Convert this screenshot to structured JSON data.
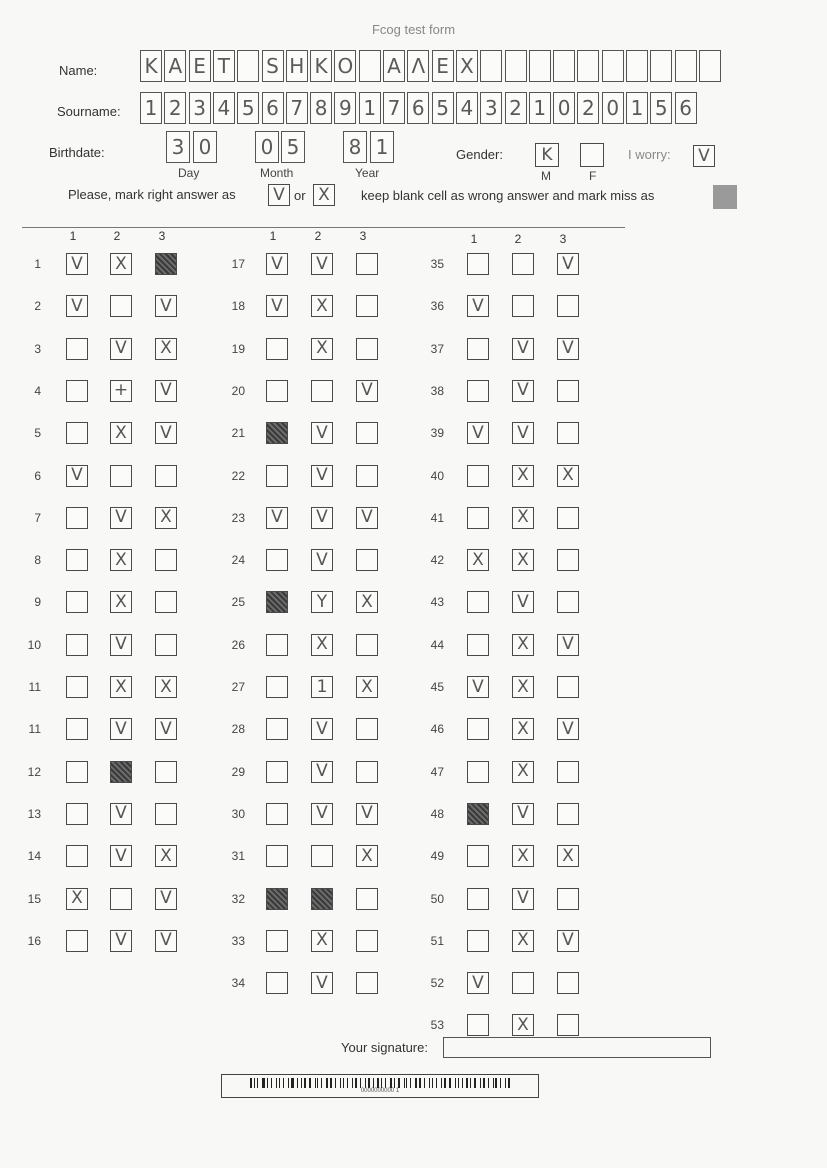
{
  "title": "Fcog test form",
  "labels": {
    "name": "Name:",
    "surname": "Sourname:",
    "birthdate": "Birthdate:",
    "day": "Day",
    "month": "Month",
    "year": "Year",
    "gender": "Gender:",
    "male": "M",
    "female": "F",
    "worry": "I worry:",
    "instructions_a": "Please, mark right answer as",
    "or": "or",
    "instructions_b": "keep blank cell as wrong answer and mark miss as",
    "signature": "Your signature:"
  },
  "name_chars": [
    "K",
    "A",
    "E",
    "T",
    "",
    "S",
    "H",
    "K",
    "O",
    "",
    "A",
    "Λ",
    "E",
    "X",
    "",
    "",
    "",
    "",
    "",
    "",
    "",
    "",
    "",
    ""
  ],
  "surname_chars": [
    "1",
    "2",
    "3",
    "4",
    "5",
    "6",
    "7",
    "8",
    "9",
    "1",
    "7",
    "6",
    "5",
    "4",
    "3",
    "2",
    "1",
    "0",
    "2",
    "0",
    "1",
    "5",
    "6"
  ],
  "birthdate": {
    "day": [
      "3",
      "0"
    ],
    "month": [
      "0",
      "5"
    ],
    "year": [
      "8",
      "1"
    ]
  },
  "gender": {
    "male": "K",
    "female": ""
  },
  "worry": "V",
  "legend_marks": {
    "right_v": "V",
    "right_x": "X"
  },
  "column_headers": [
    "1",
    "2",
    "3"
  ],
  "questions": [
    {
      "n": "1",
      "m": [
        "V",
        "X",
        "#"
      ]
    },
    {
      "n": "2",
      "m": [
        "V",
        "",
        "V"
      ]
    },
    {
      "n": "3",
      "m": [
        "",
        "V",
        "X"
      ]
    },
    {
      "n": "4",
      "m": [
        "",
        "+",
        "V"
      ]
    },
    {
      "n": "5",
      "m": [
        "",
        "X",
        "V"
      ]
    },
    {
      "n": "6",
      "m": [
        "V",
        "",
        ""
      ]
    },
    {
      "n": "7",
      "m": [
        "",
        "V",
        "X"
      ]
    },
    {
      "n": "8",
      "m": [
        "",
        "X",
        ""
      ]
    },
    {
      "n": "9",
      "m": [
        "",
        "X",
        ""
      ]
    },
    {
      "n": "10",
      "m": [
        "",
        "V",
        ""
      ]
    },
    {
      "n": "11",
      "m": [
        "",
        "X",
        "X"
      ]
    },
    {
      "n": "11",
      "m": [
        "",
        "V",
        "V"
      ]
    },
    {
      "n": "12",
      "m": [
        "",
        "#",
        ""
      ]
    },
    {
      "n": "13",
      "m": [
        "",
        "V",
        ""
      ]
    },
    {
      "n": "14",
      "m": [
        "",
        "V",
        "X"
      ]
    },
    {
      "n": "15",
      "m": [
        "X",
        "",
        "V"
      ]
    },
    {
      "n": "16",
      "m": [
        "",
        "V",
        "V"
      ]
    },
    {
      "n": "17",
      "m": [
        "V",
        "V",
        ""
      ]
    },
    {
      "n": "18",
      "m": [
        "V",
        "X",
        ""
      ]
    },
    {
      "n": "19",
      "m": [
        "",
        "X",
        ""
      ]
    },
    {
      "n": "20",
      "m": [
        "",
        "",
        "V"
      ]
    },
    {
      "n": "21",
      "m": [
        "#",
        "V",
        ""
      ]
    },
    {
      "n": "22",
      "m": [
        "",
        "V",
        ""
      ]
    },
    {
      "n": "23",
      "m": [
        "V",
        "V",
        "V"
      ]
    },
    {
      "n": "24",
      "m": [
        "",
        "V",
        ""
      ]
    },
    {
      "n": "25",
      "m": [
        "#",
        "Y",
        "X"
      ]
    },
    {
      "n": "26",
      "m": [
        "",
        "X",
        ""
      ]
    },
    {
      "n": "27",
      "m": [
        "",
        "1",
        "X"
      ]
    },
    {
      "n": "28",
      "m": [
        "",
        "V",
        ""
      ]
    },
    {
      "n": "29",
      "m": [
        "",
        "V",
        ""
      ]
    },
    {
      "n": "30",
      "m": [
        "",
        "V",
        "V"
      ]
    },
    {
      "n": "31",
      "m": [
        "",
        "",
        "X"
      ]
    },
    {
      "n": "32",
      "m": [
        "#",
        "#",
        ""
      ]
    },
    {
      "n": "33",
      "m": [
        "",
        "X",
        ""
      ]
    },
    {
      "n": "34",
      "m": [
        "",
        "V",
        ""
      ]
    },
    {
      "n": "35",
      "m": [
        "",
        "",
        "V"
      ]
    },
    {
      "n": "36",
      "m": [
        "V",
        "",
        ""
      ]
    },
    {
      "n": "37",
      "m": [
        "",
        "V",
        "V"
      ]
    },
    {
      "n": "38",
      "m": [
        "",
        "V",
        ""
      ]
    },
    {
      "n": "39",
      "m": [
        "V",
        "V",
        ""
      ]
    },
    {
      "n": "40",
      "m": [
        "",
        "X",
        "X"
      ]
    },
    {
      "n": "41",
      "m": [
        "",
        "X",
        ""
      ]
    },
    {
      "n": "42",
      "m": [
        "X",
        "X",
        ""
      ]
    },
    {
      "n": "43",
      "m": [
        "",
        "V",
        ""
      ]
    },
    {
      "n": "44",
      "m": [
        "",
        "X",
        "V"
      ]
    },
    {
      "n": "45",
      "m": [
        "V",
        "X",
        ""
      ]
    },
    {
      "n": "46",
      "m": [
        "",
        "X",
        "V"
      ]
    },
    {
      "n": "47",
      "m": [
        "",
        "X",
        ""
      ]
    },
    {
      "n": "48",
      "m": [
        "#",
        "V",
        ""
      ]
    },
    {
      "n": "49",
      "m": [
        "",
        "X",
        "X"
      ]
    },
    {
      "n": "50",
      "m": [
        "",
        "V",
        ""
      ]
    },
    {
      "n": "51",
      "m": [
        "",
        "X",
        "V"
      ]
    },
    {
      "n": "52",
      "m": [
        "V",
        "",
        ""
      ]
    },
    {
      "n": "53",
      "m": [
        "",
        "X",
        ""
      ]
    }
  ],
  "barcode_number": "0000000000 1"
}
